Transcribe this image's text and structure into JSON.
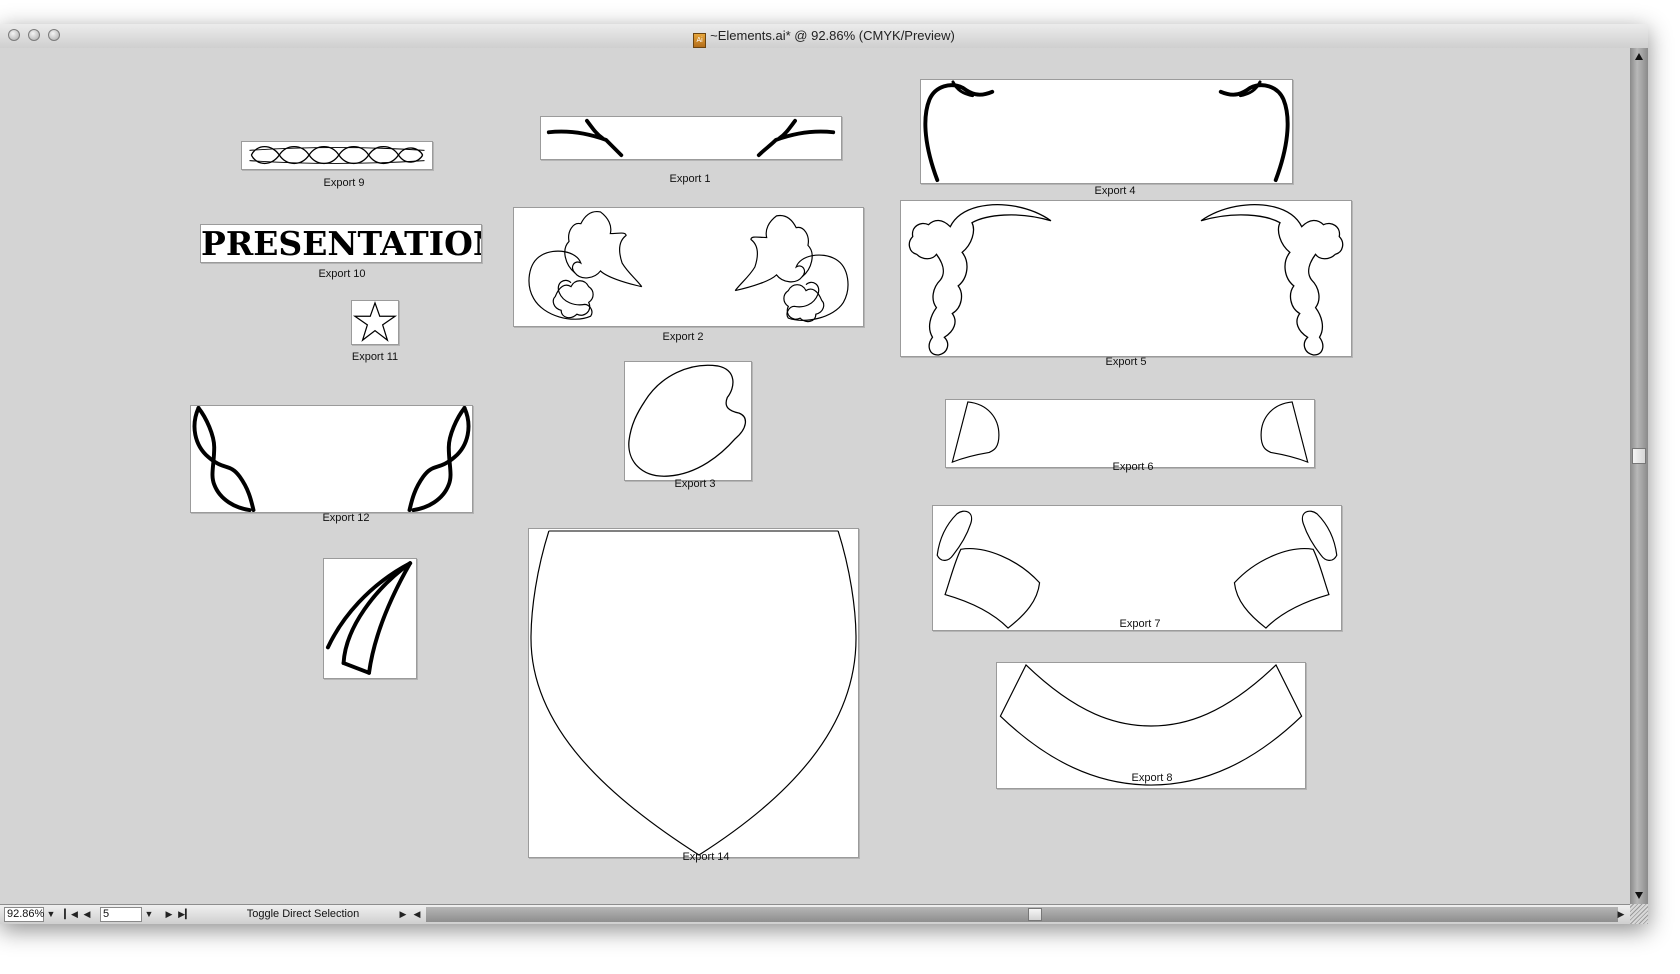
{
  "window": {
    "title": "~Elements.ai* @ 92.86% (CMYK/Preview)",
    "doc_icon": "illustrator-doc-icon",
    "doc_icon_text": "Ai"
  },
  "artboards": [
    {
      "id": "export-9",
      "label": "Export 9"
    },
    {
      "id": "export-1",
      "label": "Export 1"
    },
    {
      "id": "export-4",
      "label": "Export 4"
    },
    {
      "id": "export-10",
      "label": "Export 10",
      "text": "PRESENTATION"
    },
    {
      "id": "export-2",
      "label": "Export 2"
    },
    {
      "id": "export-5",
      "label": "Export 5"
    },
    {
      "id": "export-11",
      "label": "Export 11"
    },
    {
      "id": "export-3",
      "label": "Export 3"
    },
    {
      "id": "export-6",
      "label": "Export 6"
    },
    {
      "id": "export-12",
      "label": "Export 12"
    },
    {
      "id": "export-7",
      "label": "Export 7"
    },
    {
      "id": "export-13",
      "label": ""
    },
    {
      "id": "export-14",
      "label": "Export 14"
    },
    {
      "id": "export-8",
      "label": "Export 8"
    }
  ],
  "statusbar": {
    "zoom": "92.86%",
    "artboard_number": "5",
    "tool_hint": "Toggle Direct Selection"
  },
  "colors": {
    "canvas": "#d4d4d4",
    "artboard": "#ffffff",
    "stroke": "#000000"
  }
}
